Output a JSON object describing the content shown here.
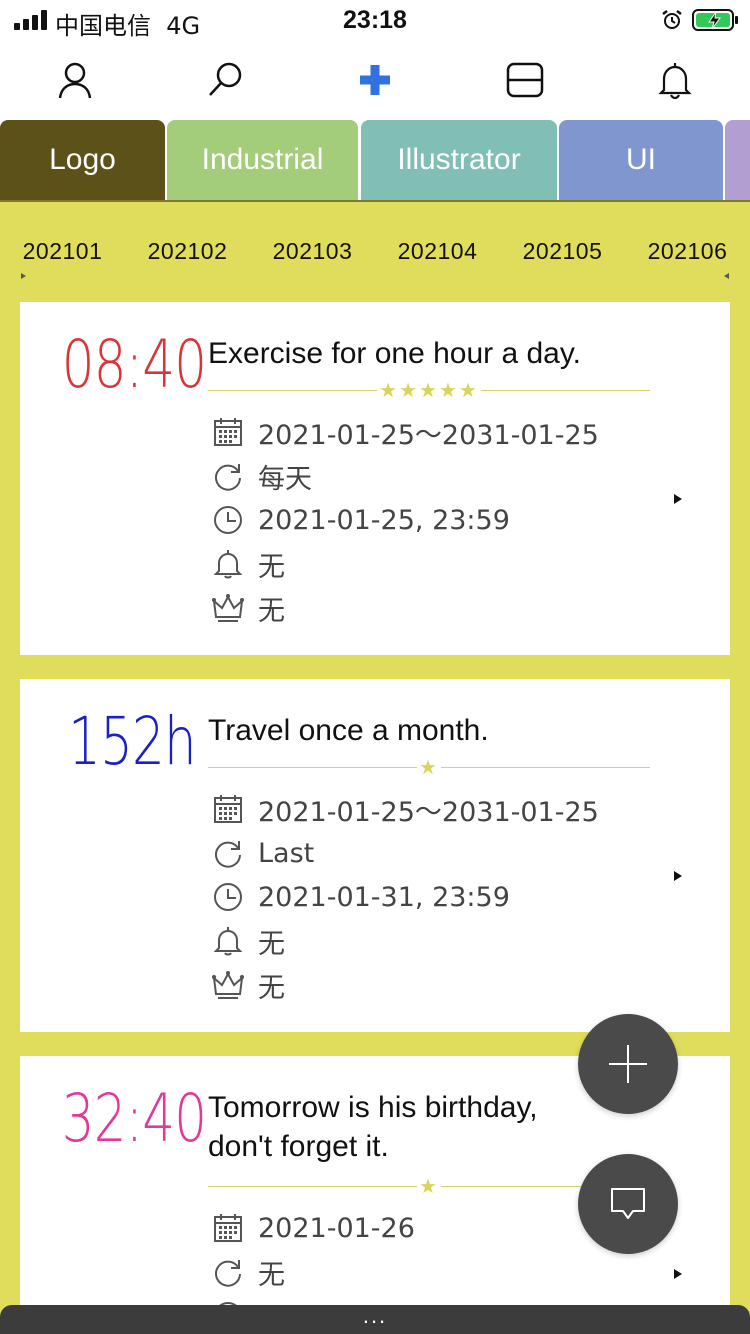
{
  "status_bar": {
    "carrier": "中国电信",
    "network": "4G",
    "time": "23:18"
  },
  "top_nav": {
    "icons": [
      "user-icon",
      "search-icon",
      "add-plus-icon",
      "layout-icon",
      "bell-icon"
    ],
    "accent": "#2f72e0"
  },
  "tabs": [
    {
      "label": "Logo",
      "color": "#5c5119"
    },
    {
      "label": "Industrial",
      "color": "#a3cc7b"
    },
    {
      "label": "Illustrator",
      "color": "#81bfb6"
    },
    {
      "label": "UI",
      "color": "#7f97ce"
    },
    {
      "label": "",
      "color": "#b29ed0"
    }
  ],
  "months": [
    "202101",
    "202102",
    "202103",
    "202104",
    "202105",
    "202106"
  ],
  "content_bg": "#e0dd5c",
  "cards": [
    {
      "time": "08:40",
      "time_color": "#d9343a",
      "title": "Exercise for one hour a day.",
      "stars": "★★★★★",
      "date_range": "2021-01-25～2031-01-25",
      "repeat": "每天",
      "deadline": "2021-01-25, 23:59",
      "reminder": "无",
      "reward": "无"
    },
    {
      "time": "152h",
      "time_color": "#1a1fc7",
      "title": "Travel once a month.",
      "stars": "★",
      "date_range": "2021-01-25～2031-01-25",
      "repeat": "Last",
      "deadline": "2021-01-31, 23:59",
      "reminder": "无",
      "reward": "无"
    },
    {
      "time": "32:40",
      "time_color": "#e0399a",
      "title": "Tomorrow is his birthday, don't forget it.",
      "stars": "★",
      "date_range": "2021-01-26",
      "repeat": "无"
    }
  ],
  "fabs": {
    "add": "plus-icon",
    "comment": "message-icon"
  },
  "bottom_handle": "..."
}
